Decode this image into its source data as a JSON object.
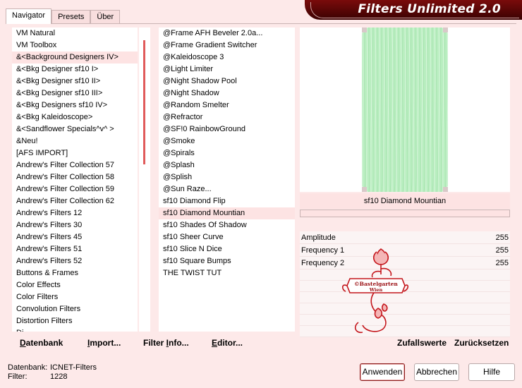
{
  "title": "Filters Unlimited 2.0",
  "tabs": [
    {
      "label": "Navigator",
      "active": true
    },
    {
      "label": "Presets",
      "active": false
    },
    {
      "label": "Über",
      "active": false
    }
  ],
  "categories": [
    {
      "label": "VM Natural"
    },
    {
      "label": "VM Toolbox"
    },
    {
      "label": "&<Background Designers IV>",
      "selected": true
    },
    {
      "label": "&<Bkg Designer sf10 I>"
    },
    {
      "label": "&<Bkg Designer sf10 II>"
    },
    {
      "label": "&<Bkg Designer sf10 III>"
    },
    {
      "label": "&<Bkg Designers sf10 IV>"
    },
    {
      "label": "&<Bkg Kaleidoscope>"
    },
    {
      "label": "&<Sandflower Specials^v^ >"
    },
    {
      "label": "&Neu!"
    },
    {
      "label": "[AFS IMPORT]"
    },
    {
      "label": "Andrew's Filter Collection 57"
    },
    {
      "label": "Andrew's Filter Collection 58"
    },
    {
      "label": "Andrew's Filter Collection 59"
    },
    {
      "label": "Andrew's Filter Collection 62"
    },
    {
      "label": "Andrew's Filters 12"
    },
    {
      "label": "Andrew's Filters 30"
    },
    {
      "label": "Andrew's Filters 45"
    },
    {
      "label": "Andrew's Filters 51"
    },
    {
      "label": "Andrew's Filters 52"
    },
    {
      "label": "Buttons & Frames"
    },
    {
      "label": "Color Effects"
    },
    {
      "label": "Color Filters"
    },
    {
      "label": "Convolution Filters"
    },
    {
      "label": "Distortion Filters"
    },
    {
      "label": "Di..."
    }
  ],
  "filters": [
    {
      "label": "@Frame AFH Beveler 2.0a..."
    },
    {
      "label": "@Frame Gradient Switcher"
    },
    {
      "label": "@Kaleidoscope 3"
    },
    {
      "label": "@Light Limiter"
    },
    {
      "label": "@Night Shadow Pool"
    },
    {
      "label": "@Night Shadow"
    },
    {
      "label": "@Random Smelter"
    },
    {
      "label": "@Refractor"
    },
    {
      "label": "@SF!0 RainbowGround"
    },
    {
      "label": "@Smoke"
    },
    {
      "label": "@Spirals"
    },
    {
      "label": "@Splash"
    },
    {
      "label": "@Splish"
    },
    {
      "label": "@Sun Raze..."
    },
    {
      "label": "sf10 Diamond Flip"
    },
    {
      "label": "sf10 Diamond Mountian",
      "selected": true
    },
    {
      "label": "sf10 Shades Of Shadow"
    },
    {
      "label": "sf10 Sheer Curve"
    },
    {
      "label": "sf10 Slice N Dice"
    },
    {
      "label": "sf10 Square Bumps"
    },
    {
      "label": "THE TWIST TUT"
    }
  ],
  "preview": {
    "filter_name": "sf10 Diamond Mountian",
    "progress_fraction": 0.0,
    "texture_color": "#b9eec0"
  },
  "parameters": [
    {
      "name": "Amplitude",
      "value": "255"
    },
    {
      "name": "Frequency 1",
      "value": "255"
    },
    {
      "name": "Frequency 2",
      "value": "255"
    }
  ],
  "watermark_text": [
    "©Bastelgarten",
    "Wien"
  ],
  "left_toolbar": {
    "database": {
      "underline": "D",
      "rest": "atenbank"
    },
    "import": {
      "underline": "I",
      "rest": "mport..."
    },
    "filter_info": {
      "pre": "Filter ",
      "underline": "I",
      "rest": "nfo..."
    },
    "editor": {
      "underline": "E",
      "rest": "ditor..."
    }
  },
  "right_toolbar": {
    "random": "Zufallswerte",
    "reset": "Zurücksetzen"
  },
  "status": {
    "database_label": "Datenbank:",
    "database_value": "ICNET-Filters",
    "filter_label": "Filter:",
    "filter_value": "1228"
  },
  "buttons": {
    "apply": "Anwenden",
    "cancel": "Abbrechen",
    "help": "Hilfe"
  },
  "colors": {
    "accent": "#7a0b0b",
    "background": "#fde9e9",
    "selection": "#fde3e3",
    "scroll_thumb": "#e05a5a"
  }
}
